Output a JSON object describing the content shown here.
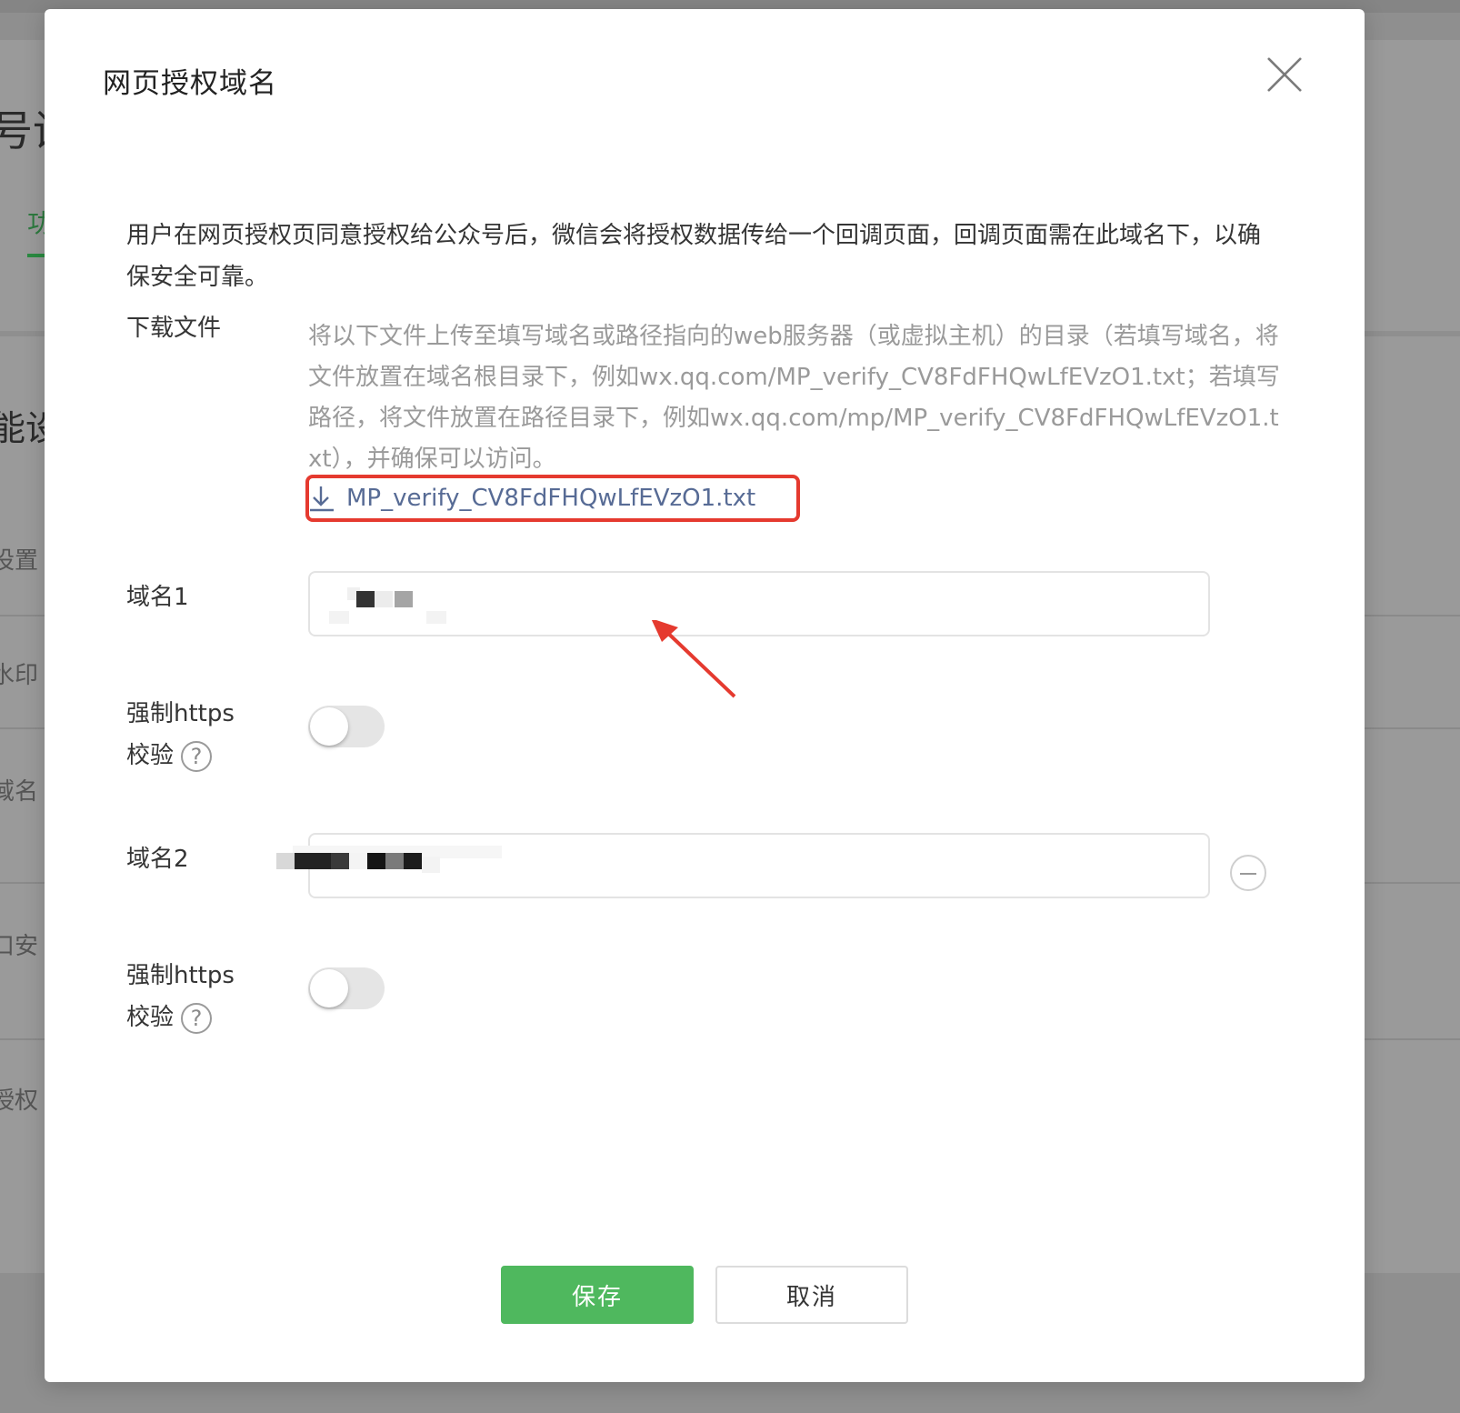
{
  "background": {
    "title_fragment": "号设",
    "tab_fragment": "功",
    "section_fragment": "能设",
    "menu_fragments": [
      "设置",
      "水印",
      "域名",
      "口安",
      "授权"
    ]
  },
  "dialog": {
    "title": "网页授权域名",
    "intro": "用户在网页授权页同意授权给公众号后，微信会将授权数据传给一个回调页面，回调页面需在此域名下，以确保安全可靠。",
    "download": {
      "label": "下载文件",
      "description": "将以下文件上传至填写域名或路径指向的web服务器（或虚拟主机）的目录（若填写域名，将文件放置在域名根目录下，例如wx.qq.com/MP_verify_CV8FdFHQwLfEVzO1.txt；若填写路径，将文件放置在路径目录下，例如wx.qq.com/mp/MP_verify_CV8FdFHQwLfEVzO1.txt），并确保可以访问。",
      "file_name": "MP_verify_CV8FdFHQwLfEVzO1.txt",
      "icon": "download-icon"
    },
    "domain1": {
      "label": "域名1",
      "value": ""
    },
    "https1": {
      "label_line1": "强制https",
      "label_line2": "校验",
      "help_glyph": "?",
      "enabled": false
    },
    "domain2": {
      "label": "域名2",
      "value": ""
    },
    "https2": {
      "label_line1": "强制https",
      "label_line2": "校验",
      "help_glyph": "?",
      "enabled": false
    },
    "buttons": {
      "save": "保存",
      "cancel": "取消"
    }
  },
  "colors": {
    "primary_green": "#4fb85e",
    "link_blue": "#576b95",
    "annotation_red": "#e53a2f",
    "muted_text": "#9a9a9a"
  }
}
